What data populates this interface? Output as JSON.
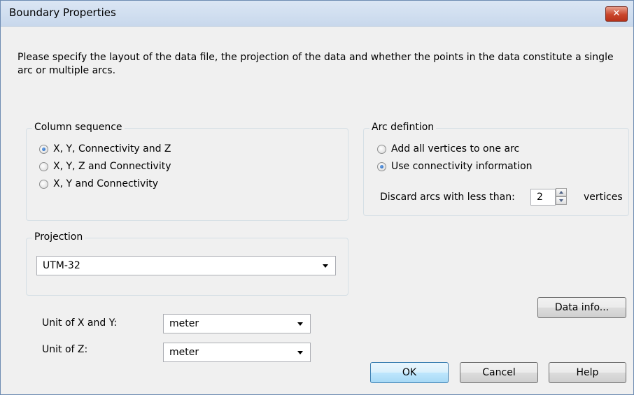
{
  "window": {
    "title": "Boundary Properties",
    "close_symbol": "✕"
  },
  "intro_text": "Please specify the layout of the data file, the projection of the data and whether the points in the data constitute a single arc or multiple arcs.",
  "column_sequence": {
    "legend": "Column sequence",
    "options": [
      {
        "label": "X, Y, Connectivity and Z",
        "checked": true
      },
      {
        "label": "X, Y, Z and Connectivity",
        "checked": false
      },
      {
        "label": "X, Y and Connectivity",
        "checked": false
      }
    ]
  },
  "arc_definition": {
    "legend": "Arc defintion",
    "options": [
      {
        "label": "Add all vertices to one arc",
        "checked": false
      },
      {
        "label": "Use connectivity information",
        "checked": true
      }
    ],
    "discard_label": "Discard arcs with less than:",
    "discard_value": "2",
    "vertices_label": "vertices"
  },
  "projection": {
    "legend": "Projection",
    "value": "UTM-32"
  },
  "units": {
    "xy_label": "Unit of X and Y:",
    "xy_value": "meter",
    "z_label": "Unit of Z:",
    "z_value": "meter"
  },
  "buttons": {
    "data_info": "Data info...",
    "ok": "OK",
    "cancel": "Cancel",
    "help": "Help"
  }
}
